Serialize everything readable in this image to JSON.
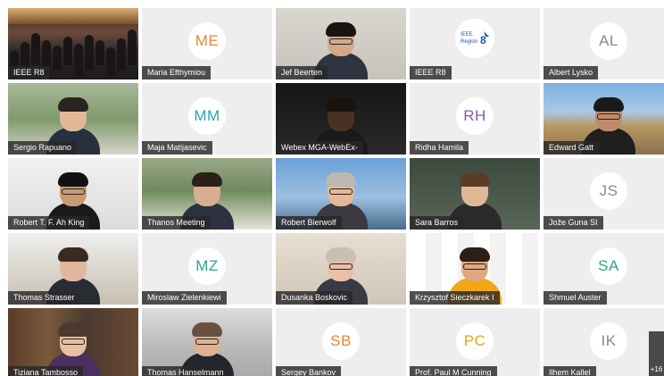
{
  "meeting": {
    "participants": [
      {
        "name": "IEEE R8",
        "kind": "video",
        "scene": "conference-hall"
      },
      {
        "name": "Maria Efthymiou",
        "kind": "initials",
        "initials": "ME",
        "color": "#e8833a"
      },
      {
        "name": "Jef Beerten",
        "kind": "video",
        "scene": "person-glasses-curly"
      },
      {
        "name": "IEEE R8",
        "kind": "logo",
        "logo_icon": "ieee-region8-logo"
      },
      {
        "name": "Albert Lysko",
        "kind": "initials",
        "initials": "AL",
        "color": "#8a8a8a"
      },
      {
        "name": "Sergio Rapuano",
        "kind": "video",
        "scene": "person-garden"
      },
      {
        "name": "Maja Matijasevic",
        "kind": "initials",
        "initials": "MM",
        "color": "#2aa6b0"
      },
      {
        "name": "Webex MGA-WebEx-",
        "kind": "video",
        "scene": "person-dark"
      },
      {
        "name": "Ridha Hamila",
        "kind": "initials",
        "initials": "RH",
        "color": "#8f56a8"
      },
      {
        "name": "Edward Gatt",
        "kind": "video",
        "scene": "person-building"
      },
      {
        "name": "Robert T. F. Ah King",
        "kind": "video",
        "scene": "person-glasses-white"
      },
      {
        "name": "Thanos Meeting",
        "kind": "video",
        "scene": "person-trees"
      },
      {
        "name": "Robert Bierwolf",
        "kind": "video",
        "scene": "person-city"
      },
      {
        "name": "Sara Barros",
        "kind": "video",
        "scene": "person-woman-office"
      },
      {
        "name": "Jože Guna SI",
        "kind": "initials",
        "initials": "JS",
        "color": "#8a8a8a"
      },
      {
        "name": "Thomas Strasser",
        "kind": "video",
        "scene": "person-shelves"
      },
      {
        "name": "Miroslaw Zielenkiewi",
        "kind": "initials",
        "initials": "MZ",
        "color": "#2aa68a"
      },
      {
        "name": "Dusanka Boskovic",
        "kind": "video",
        "scene": "person-frames"
      },
      {
        "name": "Krzysztof Sieczkarek I",
        "kind": "video",
        "scene": "person-online-backdrop"
      },
      {
        "name": "Shmuel Auster",
        "kind": "initials",
        "initials": "SA",
        "color": "#2aa68a"
      },
      {
        "name": "Tiziana Tambosso",
        "kind": "video",
        "scene": "person-books"
      },
      {
        "name": "Thomas Hanselmann",
        "kind": "video",
        "scene": "person-window"
      },
      {
        "name": "Sergey Bankov",
        "kind": "initials",
        "initials": "SB",
        "color": "#e8833a"
      },
      {
        "name": "Prof. Paul M Cunning",
        "kind": "initials",
        "initials": "PC",
        "color": "#e0a81a"
      },
      {
        "name": "Ilhem Kallel",
        "kind": "initials",
        "initials": "IK",
        "color": "#8a8a8a"
      }
    ],
    "more_count": "+16"
  }
}
